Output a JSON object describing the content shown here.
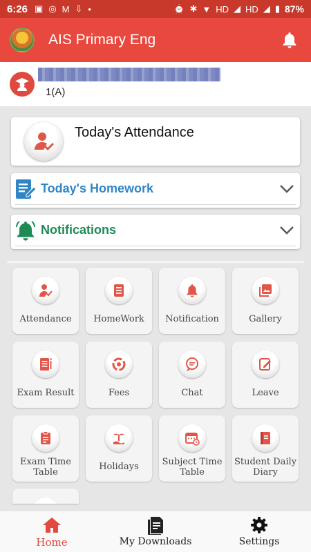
{
  "status_bar": {
    "time": "6:26",
    "network_label": "HD",
    "battery": "87%"
  },
  "app_bar": {
    "title": "AIS Primary Eng"
  },
  "profile": {
    "class_label": "1(A)"
  },
  "attendance_card": {
    "title": "Today's Attendance"
  },
  "homework_panel": {
    "title": "Today's Homework"
  },
  "notifications_panel": {
    "title": "Notifications"
  },
  "menu_tiles": [
    {
      "label": "Attendance",
      "icon": "attendance-icon"
    },
    {
      "label": "HomeWork",
      "icon": "homework-icon"
    },
    {
      "label": "Notification",
      "icon": "notification-icon"
    },
    {
      "label": "Gallery",
      "icon": "gallery-icon"
    },
    {
      "label": "Exam Result",
      "icon": "exam-result-icon"
    },
    {
      "label": "Fees",
      "icon": "fees-icon"
    },
    {
      "label": "Chat",
      "icon": "chat-icon"
    },
    {
      "label": "Leave",
      "icon": "leave-icon"
    },
    {
      "label": "Exam Time Table",
      "icon": "exam-time-table-icon"
    },
    {
      "label": "Holidays",
      "icon": "holidays-icon"
    },
    {
      "label": "Subject Time Table",
      "icon": "subject-time-table-icon"
    },
    {
      "label": "Student Daily Diary",
      "icon": "student-daily-diary-icon"
    }
  ],
  "bottom_nav": [
    {
      "label": "Home",
      "icon": "home-icon",
      "active": true
    },
    {
      "label": "My Downloads",
      "icon": "downloads-icon",
      "active": false
    },
    {
      "label": "Settings",
      "icon": "settings-gear-icon",
      "active": false
    }
  ],
  "colors": {
    "primary": "#e8483d",
    "homework_title": "#2f86c6",
    "notifications_title": "#1e8a55",
    "icon_accent": "#e2564a"
  }
}
